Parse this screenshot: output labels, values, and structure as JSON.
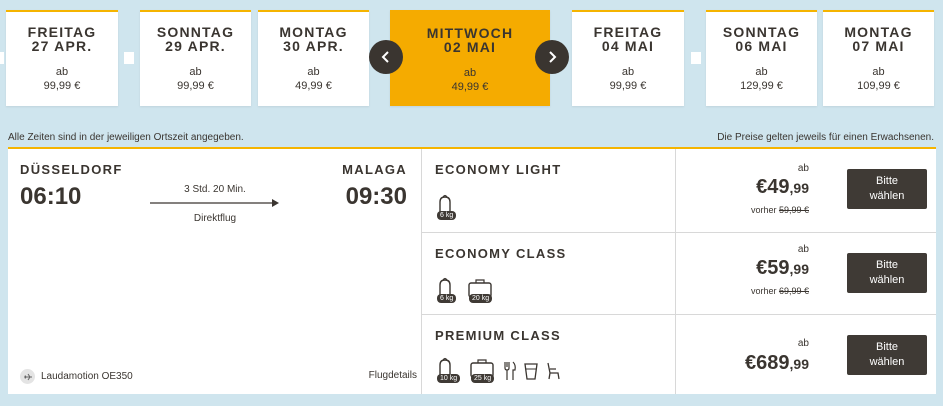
{
  "dates": [
    {
      "day": "FREITAG",
      "date": "27 APR.",
      "ab": "ab",
      "price": "99,99 €"
    },
    {
      "day": "SONNTAG",
      "date": "29 APR.",
      "ab": "ab",
      "price": "99,99 €"
    },
    {
      "day": "MONTAG",
      "date": "30 APR.",
      "ab": "ab",
      "price": "49,99 €"
    },
    {
      "day": "MITTWOCH",
      "date": "02 MAI",
      "ab": "ab",
      "price": "49,99 €"
    },
    {
      "day": "FREITAG",
      "date": "04 MAI",
      "ab": "ab",
      "price": "99,99 €"
    },
    {
      "day": "SONNTAG",
      "date": "06 MAI",
      "ab": "ab",
      "price": "129,99 €"
    },
    {
      "day": "MONTAG",
      "date": "07 MAI",
      "ab": "ab",
      "price": "109,99 €"
    }
  ],
  "notes": {
    "left": "Alle Zeiten sind in der jeweiligen Ortszeit angegeben.",
    "right": "Die Preise gelten jeweils für einen Erwachsenen."
  },
  "flight": {
    "origin": "DÜSSELDORF",
    "depart_time": "06:10",
    "destination": "MALAGA",
    "arrive_time": "09:30",
    "duration": "3 Std. 20 Min.",
    "type": "Direktflug",
    "airline": "Laudamotion OE350",
    "details": "Flugdetails"
  },
  "fares": [
    {
      "name": "ECONOMY LIGHT",
      "ab": "ab",
      "currency": "€",
      "whole": "49",
      "cents": ",99",
      "previous_label": "vorher",
      "previous": "59,99 €",
      "button": [
        "Bitte",
        "wählen"
      ],
      "bags": [
        "6 kg"
      ]
    },
    {
      "name": "ECONOMY CLASS",
      "ab": "ab",
      "currency": "€",
      "whole": "59",
      "cents": ",99",
      "previous_label": "vorher",
      "previous": "69,99 €",
      "button": [
        "Bitte",
        "wählen"
      ],
      "bags": [
        "6 kg",
        "20 kg"
      ]
    },
    {
      "name": "PREMIUM CLASS",
      "ab": "ab",
      "currency": "€",
      "whole": "689",
      "cents": ",99",
      "button": [
        "Bitte",
        "wählen"
      ],
      "bags": [
        "10 kg",
        "25 kg"
      ]
    }
  ],
  "colors": {
    "accent": "#f5ab00",
    "dark": "#3f3a35",
    "background": "#cfe5ee"
  }
}
